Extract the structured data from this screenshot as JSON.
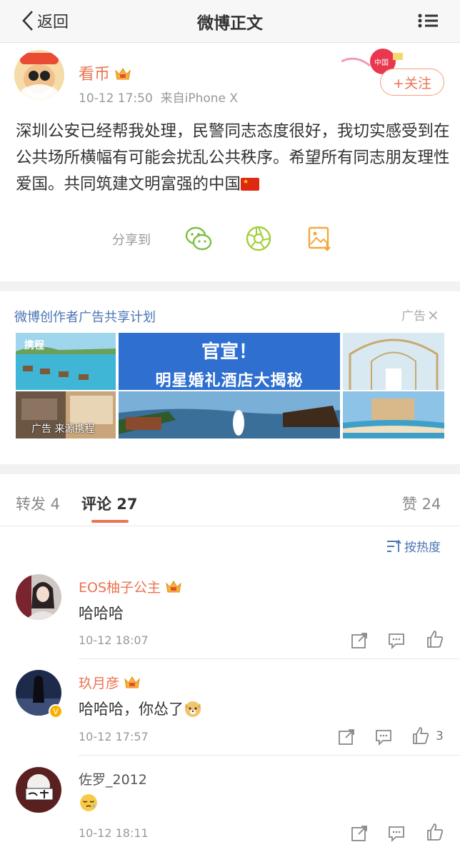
{
  "nav": {
    "back_label": "返回",
    "title": "微博正文"
  },
  "post": {
    "username": "看币",
    "time": "10-12 17:50",
    "source": "来自iPhone X",
    "follow_label": "+关注",
    "text": "深圳公安已经帮我处理，民警同志态度很好，我切实感受到在公共场所横幅有可能会扰乱公共秩序。希望所有同志朋友理性爱国。共同筑建文明富强的中国",
    "share_label": "分享到"
  },
  "ad": {
    "title": "微博创作者广告共享计划",
    "label": "广告",
    "close": "×",
    "banner_line1": "官宣！",
    "banner_line2": "明星婚礼酒店大揭秘",
    "brand": "携程",
    "source_text": "广告 来源携程"
  },
  "tabs": {
    "repost": "转发 4",
    "comment": "评论 27",
    "like": "赞 24"
  },
  "sort_label": "按热度",
  "comments": [
    {
      "name": "EOS柚子公主",
      "text": "哈哈哈",
      "time": "10-12 18:07",
      "likes": ""
    },
    {
      "name": "玖月彦",
      "text": "哈哈哈，你怂了",
      "time": "10-12 17:57",
      "likes": "3"
    },
    {
      "name": "佐罗_2012",
      "text": "",
      "time": "10-12 18:11",
      "likes": ""
    }
  ],
  "colors": {
    "accent": "#eb7350",
    "link": "#4a75b5",
    "gap": "#f2f2f2"
  }
}
